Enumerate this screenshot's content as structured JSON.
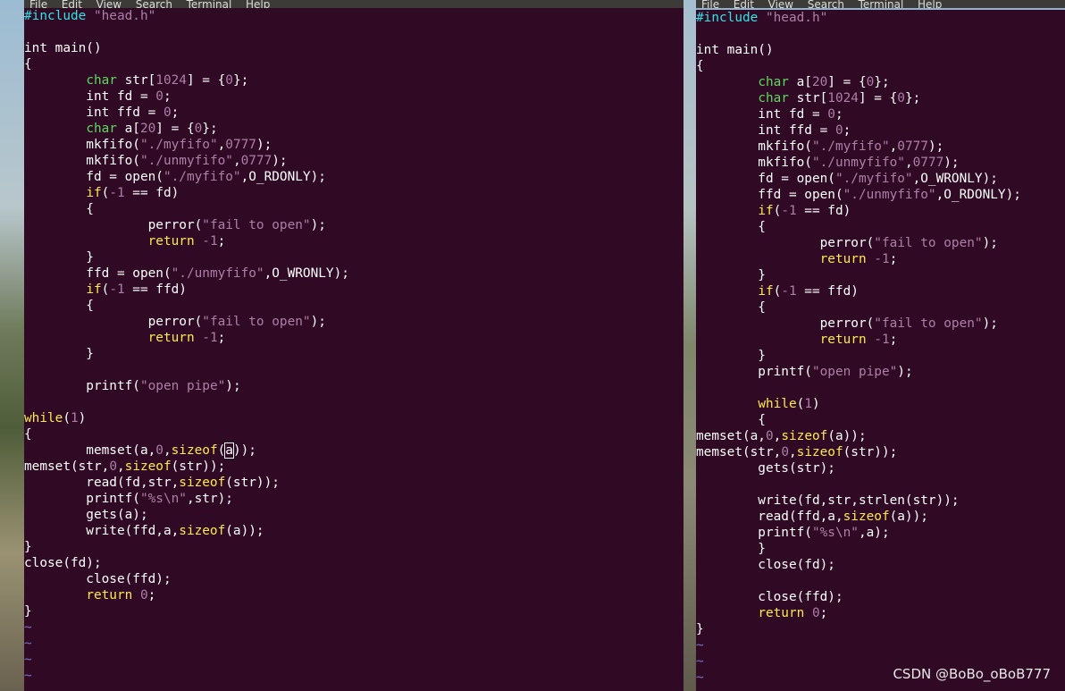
{
  "menu": [
    "File",
    "Edit",
    "View",
    "Search",
    "Terminal",
    "Help"
  ],
  "colors": {
    "editor_bg": "#300a24",
    "keyword": "#5fd75f",
    "string": "#ad7fa8",
    "preproc": "#34e2e2",
    "control": "#fce94f",
    "default": "#ffffff"
  },
  "left_editor": {
    "lines": [
      [
        [
          "pre",
          "#include "
        ],
        [
          "str",
          "\"head.h\""
        ]
      ],
      [],
      [
        [
          "",
          "int main()"
        ]
      ],
      [
        [
          "",
          "{"
        ]
      ],
      [
        [
          "",
          "        "
        ],
        [
          "typ",
          "char"
        ],
        [
          "",
          " str["
        ],
        [
          "num",
          "1024"
        ],
        [
          "",
          "] = {"
        ],
        [
          "num",
          "0"
        ],
        [
          "",
          "};"
        ]
      ],
      [
        [
          "",
          "        int fd = "
        ],
        [
          "num",
          "0"
        ],
        [
          "",
          ";"
        ]
      ],
      [
        [
          "",
          "        int ffd = "
        ],
        [
          "num",
          "0"
        ],
        [
          "",
          ";"
        ]
      ],
      [
        [
          "",
          "        "
        ],
        [
          "typ",
          "char"
        ],
        [
          "",
          " a["
        ],
        [
          "num",
          "20"
        ],
        [
          "",
          "] = {"
        ],
        [
          "num",
          "0"
        ],
        [
          "",
          "};"
        ]
      ],
      [
        [
          "",
          "        mkfifo("
        ],
        [
          "str",
          "\"./myfifo\""
        ],
        [
          "",
          ","
        ],
        [
          "num",
          "0777"
        ],
        [
          "",
          ");"
        ]
      ],
      [
        [
          "",
          "        mkfifo("
        ],
        [
          "str",
          "\"./unmyfifo\""
        ],
        [
          "",
          ","
        ],
        [
          "num",
          "0777"
        ],
        [
          "",
          ");"
        ]
      ],
      [
        [
          "",
          "        fd = open("
        ],
        [
          "str",
          "\"./myfifo\""
        ],
        [
          "",
          ",O_RDONLY);"
        ]
      ],
      [
        [
          "",
          "        "
        ],
        [
          "ctl",
          "if"
        ],
        [
          "",
          "("
        ],
        [
          "num",
          "-1"
        ],
        [
          "",
          " == fd)"
        ]
      ],
      [
        [
          "",
          "        {"
        ]
      ],
      [
        [
          "",
          "                perror("
        ],
        [
          "str",
          "\"fail to open\""
        ],
        [
          "",
          ");"
        ]
      ],
      [
        [
          "",
          "                "
        ],
        [
          "ctl",
          "return"
        ],
        [
          "",
          " "
        ],
        [
          "num",
          "-1"
        ],
        [
          "",
          ";"
        ]
      ],
      [
        [
          "",
          "        }"
        ]
      ],
      [
        [
          "",
          "        ffd = open("
        ],
        [
          "str",
          "\"./unmyfifo\""
        ],
        [
          "",
          ",O_WRONLY);"
        ]
      ],
      [
        [
          "",
          "        "
        ],
        [
          "ctl",
          "if"
        ],
        [
          "",
          "("
        ],
        [
          "num",
          "-1"
        ],
        [
          "",
          " == ffd)"
        ]
      ],
      [
        [
          "",
          "        {"
        ]
      ],
      [
        [
          "",
          "                perror("
        ],
        [
          "str",
          "\"fail to open\""
        ],
        [
          "",
          ");"
        ]
      ],
      [
        [
          "",
          "                "
        ],
        [
          "ctl",
          "return"
        ],
        [
          "",
          " "
        ],
        [
          "num",
          "-1"
        ],
        [
          "",
          ";"
        ]
      ],
      [
        [
          "",
          "        }"
        ]
      ],
      [],
      [
        [
          "",
          "        printf("
        ],
        [
          "str",
          "\"open pipe\""
        ],
        [
          "",
          ");"
        ]
      ],
      [],
      [
        [
          "ctl",
          "while"
        ],
        [
          "",
          "("
        ],
        [
          "num",
          "1"
        ],
        [
          "",
          ")"
        ]
      ],
      [
        [
          "",
          "{"
        ]
      ],
      [
        [
          "",
          "        memset(a,"
        ],
        [
          "num",
          "0"
        ],
        [
          "",
          ","
        ],
        [
          "ctl",
          "sizeof"
        ],
        [
          "",
          "("
        ],
        [
          "cur",
          "a"
        ],
        [
          "",
          "));"
        ]
      ],
      [
        [
          "",
          "memset(str,"
        ],
        [
          "num",
          "0"
        ],
        [
          "",
          ","
        ],
        [
          "ctl",
          "sizeof"
        ],
        [
          "",
          "(str));"
        ]
      ],
      [
        [
          "",
          "        read(fd,str,"
        ],
        [
          "ctl",
          "sizeof"
        ],
        [
          "",
          "(str));"
        ]
      ],
      [
        [
          "",
          "        printf("
        ],
        [
          "str",
          "\"%s\\n\""
        ],
        [
          "",
          ",str);"
        ]
      ],
      [
        [
          "",
          "        gets(a);"
        ]
      ],
      [
        [
          "",
          "        write(ffd,a,"
        ],
        [
          "ctl",
          "sizeof"
        ],
        [
          "",
          "(a));"
        ]
      ],
      [
        [
          "",
          "}"
        ]
      ],
      [
        [
          "",
          "close(fd);"
        ]
      ],
      [
        [
          "",
          "        close(ffd);"
        ]
      ],
      [
        [
          "",
          "        "
        ],
        [
          "ctl",
          "return"
        ],
        [
          "",
          " "
        ],
        [
          "num",
          "0"
        ],
        [
          "",
          ";"
        ]
      ],
      [
        [
          "",
          "}"
        ]
      ],
      [
        [
          "tilde",
          "~"
        ]
      ],
      [
        [
          "tilde",
          "~"
        ]
      ],
      [
        [
          "tilde",
          "~"
        ]
      ],
      [
        [
          "tilde",
          "~"
        ]
      ]
    ]
  },
  "right_editor": {
    "lines": [
      [
        [
          "pre",
          "#include "
        ],
        [
          "str",
          "\"head.h\""
        ]
      ],
      [],
      [
        [
          "",
          "int main()"
        ]
      ],
      [
        [
          "",
          "{"
        ]
      ],
      [
        [
          "",
          "        "
        ],
        [
          "typ",
          "char"
        ],
        [
          "",
          " a["
        ],
        [
          "num",
          "20"
        ],
        [
          "",
          "] = {"
        ],
        [
          "num",
          "0"
        ],
        [
          "",
          "};"
        ]
      ],
      [
        [
          "",
          "        "
        ],
        [
          "typ",
          "char"
        ],
        [
          "",
          " str["
        ],
        [
          "num",
          "1024"
        ],
        [
          "",
          "] = {"
        ],
        [
          "num",
          "0"
        ],
        [
          "",
          "};"
        ]
      ],
      [
        [
          "",
          "        int fd = "
        ],
        [
          "num",
          "0"
        ],
        [
          "",
          ";"
        ]
      ],
      [
        [
          "",
          "        int ffd = "
        ],
        [
          "num",
          "0"
        ],
        [
          "",
          ";"
        ]
      ],
      [
        [
          "",
          "        mkfifo("
        ],
        [
          "str",
          "\"./myfifo\""
        ],
        [
          "",
          ","
        ],
        [
          "num",
          "0777"
        ],
        [
          "",
          ");"
        ]
      ],
      [
        [
          "",
          "        mkfifo("
        ],
        [
          "str",
          "\"./unmyfifo\""
        ],
        [
          "",
          ","
        ],
        [
          "num",
          "0777"
        ],
        [
          "",
          ");"
        ]
      ],
      [
        [
          "",
          "        fd = open("
        ],
        [
          "str",
          "\"./myfifo\""
        ],
        [
          "",
          ",O_WRONLY);"
        ]
      ],
      [
        [
          "",
          "        ffd = open("
        ],
        [
          "str",
          "\"./unmyfifo\""
        ],
        [
          "",
          ",O_RDONLY);"
        ]
      ],
      [
        [
          "",
          "        "
        ],
        [
          "ctl",
          "if"
        ],
        [
          "",
          "("
        ],
        [
          "num",
          "-1"
        ],
        [
          "",
          " == fd)"
        ]
      ],
      [
        [
          "",
          "        {"
        ]
      ],
      [
        [
          "",
          "                perror("
        ],
        [
          "str",
          "\"fail to open\""
        ],
        [
          "",
          ");"
        ]
      ],
      [
        [
          "",
          "                "
        ],
        [
          "ctl",
          "return"
        ],
        [
          "",
          " "
        ],
        [
          "num",
          "-1"
        ],
        [
          "",
          ";"
        ]
      ],
      [
        [
          "",
          "        }"
        ]
      ],
      [
        [
          "",
          "        "
        ],
        [
          "ctl",
          "if"
        ],
        [
          "",
          "("
        ],
        [
          "num",
          "-1"
        ],
        [
          "",
          " == ffd)"
        ]
      ],
      [
        [
          "",
          "        {"
        ]
      ],
      [
        [
          "",
          "                perror("
        ],
        [
          "str",
          "\"fail to open\""
        ],
        [
          "",
          ");"
        ]
      ],
      [
        [
          "",
          "                "
        ],
        [
          "ctl",
          "return"
        ],
        [
          "",
          " "
        ],
        [
          "num",
          "-1"
        ],
        [
          "",
          ";"
        ]
      ],
      [
        [
          "",
          "        }"
        ]
      ],
      [
        [
          "",
          "        printf("
        ],
        [
          "str",
          "\"open pipe\""
        ],
        [
          "",
          ");"
        ]
      ],
      [],
      [
        [
          "",
          "        "
        ],
        [
          "ctl",
          "while"
        ],
        [
          "",
          "("
        ],
        [
          "num",
          "1"
        ],
        [
          "",
          ")"
        ]
      ],
      [
        [
          "",
          "        {"
        ]
      ],
      [
        [
          "",
          "memset(a,"
        ],
        [
          "num",
          "0"
        ],
        [
          "",
          ","
        ],
        [
          "ctl",
          "sizeof"
        ],
        [
          "",
          "(a));"
        ]
      ],
      [
        [
          "",
          "memset(str,"
        ],
        [
          "num",
          "0"
        ],
        [
          "",
          ","
        ],
        [
          "ctl",
          "sizeof"
        ],
        [
          "",
          "(str));"
        ]
      ],
      [
        [
          "",
          "        gets(str);"
        ]
      ],
      [],
      [
        [
          "",
          "        write(fd,str,strlen(str));"
        ]
      ],
      [
        [
          "",
          "        read(ffd,a,"
        ],
        [
          "ctl",
          "sizeof"
        ],
        [
          "",
          "(a));"
        ]
      ],
      [
        [
          "",
          "        printf("
        ],
        [
          "str",
          "\"%s\\n\""
        ],
        [
          "",
          ",a);"
        ]
      ],
      [
        [
          "",
          "        }"
        ]
      ],
      [
        [
          "",
          "        close(fd);"
        ]
      ],
      [],
      [
        [
          "",
          "        close(ffd);"
        ]
      ],
      [
        [
          "",
          "        "
        ],
        [
          "ctl",
          "return"
        ],
        [
          "",
          " "
        ],
        [
          "num",
          "0"
        ],
        [
          "",
          ";"
        ]
      ],
      [
        [
          "",
          "}"
        ]
      ],
      [
        [
          "tilde",
          "~"
        ]
      ],
      [
        [
          "tilde",
          "~"
        ]
      ],
      [
        [
          "tilde",
          "~"
        ]
      ]
    ]
  },
  "watermark": "CSDN @BoBo_oBoB777"
}
